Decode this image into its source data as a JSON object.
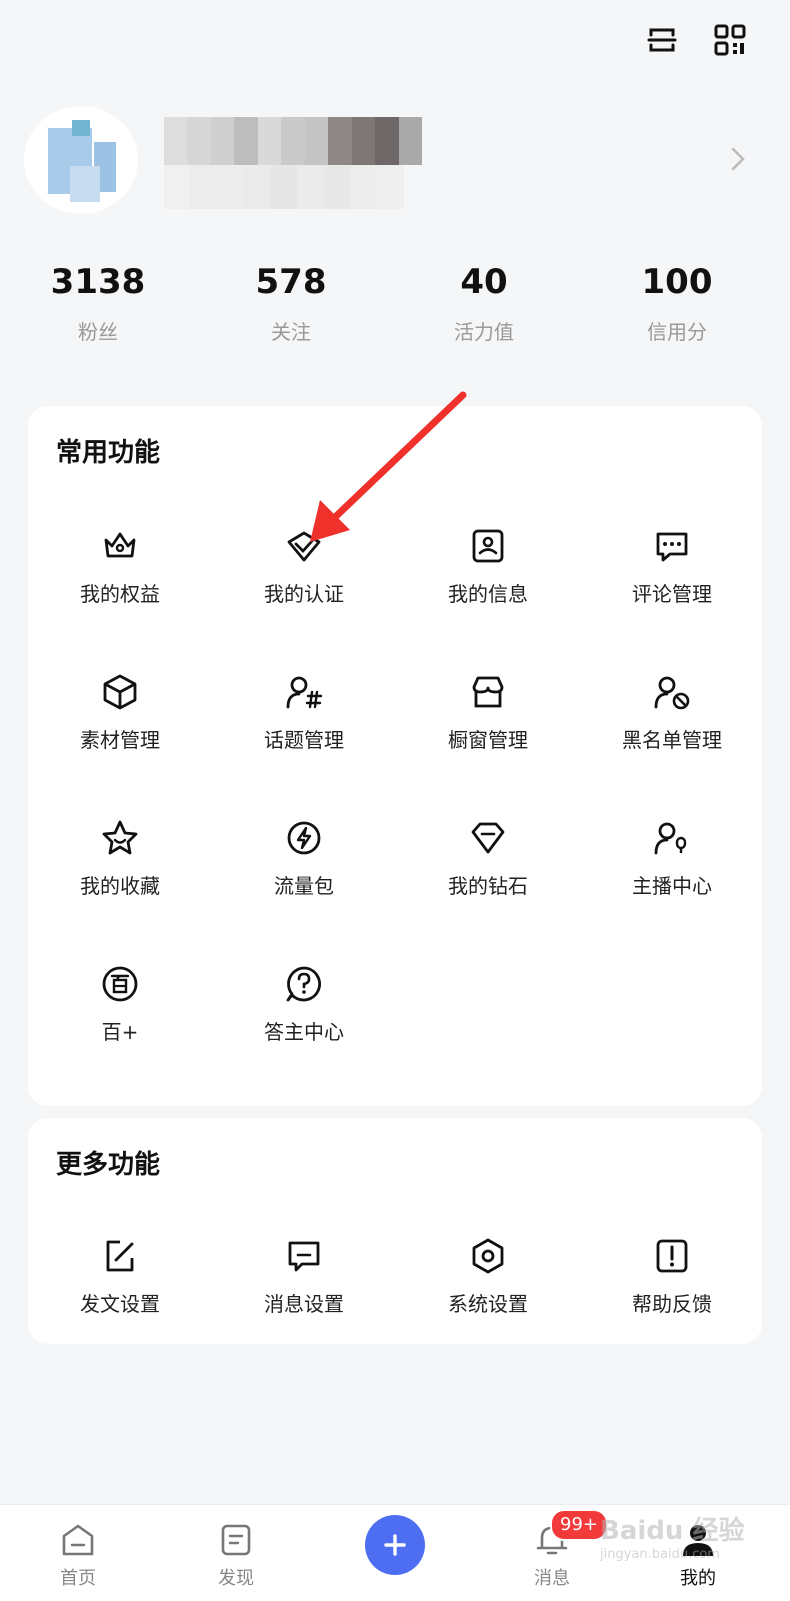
{
  "profile": {
    "stats": [
      {
        "value": "3138",
        "label": "粉丝"
      },
      {
        "value": "578",
        "label": "关注"
      },
      {
        "value": "40",
        "label": "活力值"
      },
      {
        "value": "100",
        "label": "信用分"
      }
    ]
  },
  "common": {
    "title": "常用功能",
    "items": [
      {
        "label": "我的权益",
        "icon": "crown-icon"
      },
      {
        "label": "我的认证",
        "icon": "verify-icon"
      },
      {
        "label": "我的信息",
        "icon": "id-card-icon"
      },
      {
        "label": "评论管理",
        "icon": "comment-icon"
      },
      {
        "label": "素材管理",
        "icon": "cube-icon"
      },
      {
        "label": "话题管理",
        "icon": "topic-icon"
      },
      {
        "label": "橱窗管理",
        "icon": "shop-icon"
      },
      {
        "label": "黑名单管理",
        "icon": "blocked-user-icon"
      },
      {
        "label": "我的收藏",
        "icon": "star-icon"
      },
      {
        "label": "流量包",
        "icon": "lightning-icon"
      },
      {
        "label": "我的钻石",
        "icon": "diamond-icon"
      },
      {
        "label": "主播中心",
        "icon": "anchor-icon"
      },
      {
        "label": "百+",
        "icon": "bai-plus-icon"
      },
      {
        "label": "答主中心",
        "icon": "question-icon"
      }
    ]
  },
  "more": {
    "title": "更多功能",
    "items": [
      {
        "label": "发文设置",
        "icon": "edit-icon"
      },
      {
        "label": "消息设置",
        "icon": "message-icon"
      },
      {
        "label": "系统设置",
        "icon": "settings-icon"
      },
      {
        "label": "帮助反馈",
        "icon": "feedback-icon"
      }
    ]
  },
  "nav": {
    "items": [
      {
        "label": "首页",
        "icon": "home-icon"
      },
      {
        "label": "发现",
        "icon": "discover-icon"
      },
      {
        "label": "",
        "icon": "add-icon"
      },
      {
        "label": "消息",
        "icon": "bell-icon",
        "badge": "99+"
      },
      {
        "label": "我的",
        "icon": "user-icon",
        "active": true
      }
    ]
  },
  "watermark": {
    "main": "Baidu 经验",
    "sub": "jingyan.baidu.com"
  },
  "colors": {
    "accent": "#4e6ef2",
    "badge": "#f23a3a",
    "annotation_arrow": "#f0302b"
  }
}
